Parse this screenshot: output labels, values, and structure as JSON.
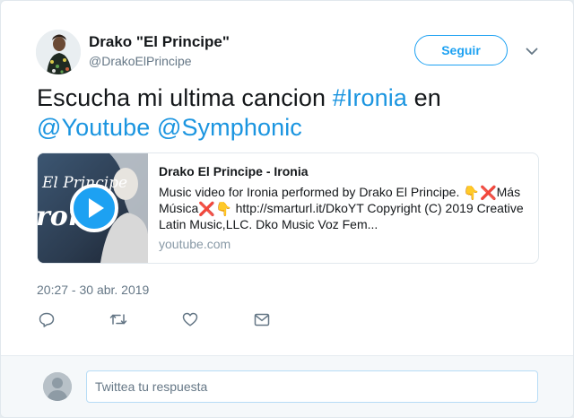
{
  "author": {
    "display_name": "Drako \"El Principe\"",
    "handle": "@DrakoElPrincipe",
    "avatar_icon": "profile-avatar-icon"
  },
  "header": {
    "follow_label": "Seguir",
    "menu_icon": "chevron-down-icon"
  },
  "tweet": {
    "text_before": "Escucha mi ultima cancion ",
    "hashtag": "#Ironia",
    "text_middle": " en",
    "mentions": [
      "@Youtube",
      "@Symphonic"
    ],
    "timestamp": "20:27 - 30 abr. 2019"
  },
  "link_card": {
    "thumbnail_text": "El Principe",
    "thumbnail_text_2": "roni",
    "title": "Drako El Principe - Ironia",
    "description_1": "Music video for Ironia performed by Drako El Principe. ",
    "emoji_down": "👇",
    "emoji_cross": "❌",
    "description_2": "Más Música",
    "description_3": " http://smarturl.it/DkoYT Copyright (C) 2019 Creative Latin Music,LLC. Dko Music Voz Fem...",
    "domain": "youtube.com",
    "play_icon": "play-icon"
  },
  "actions": [
    {
      "name": "reply-icon"
    },
    {
      "name": "retweet-icon"
    },
    {
      "name": "like-icon"
    },
    {
      "name": "direct-message-icon"
    }
  ],
  "reply": {
    "placeholder": "Twittea tu respuesta"
  },
  "colors": {
    "accent": "#1da1f2",
    "link": "#1b95e0",
    "muted": "#657786",
    "background": "#e6ecf0"
  }
}
